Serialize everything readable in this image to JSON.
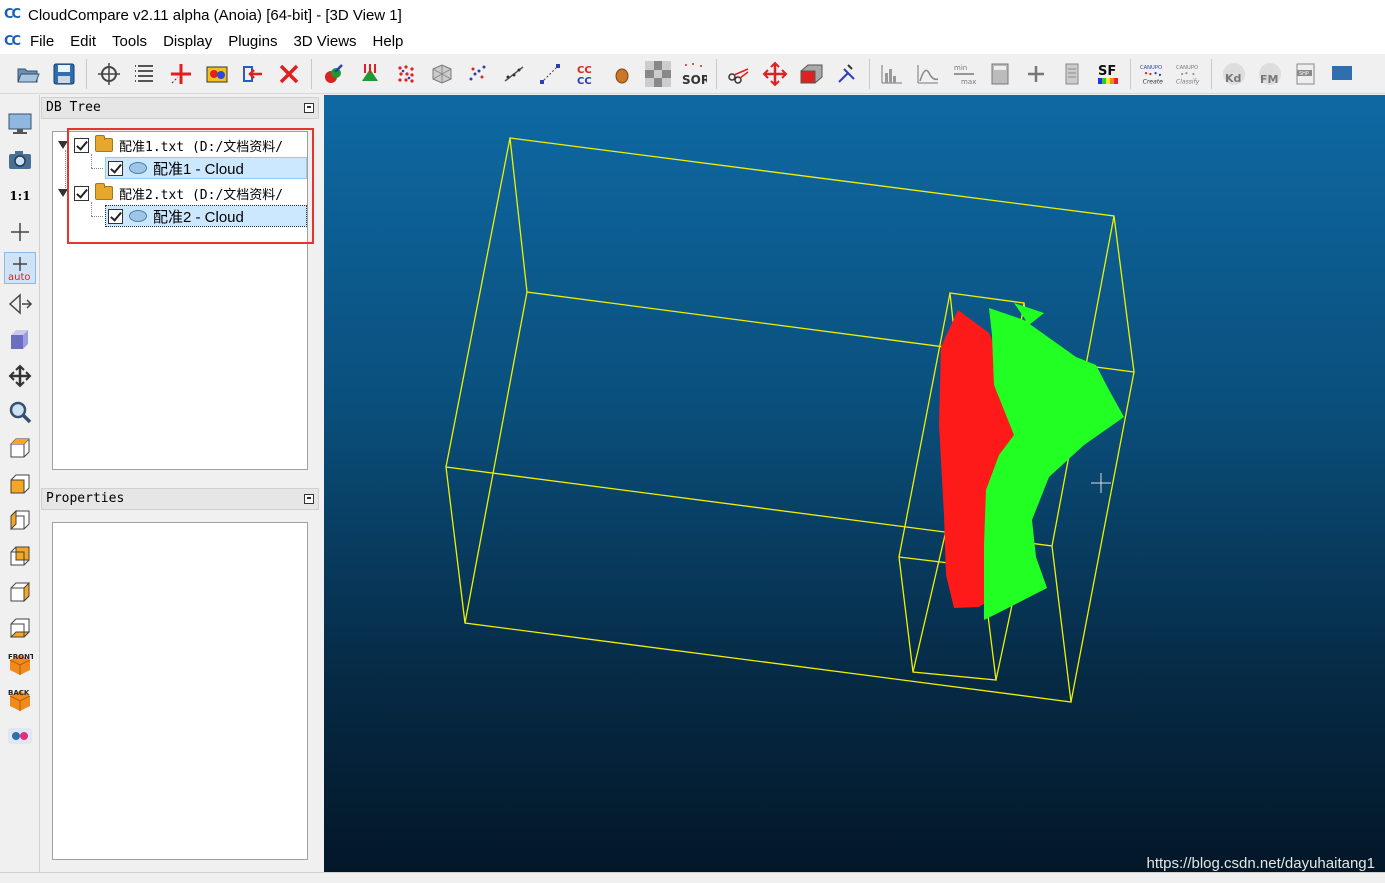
{
  "window": {
    "logo": "CC",
    "title": "CloudCompare v2.11 alpha (Anoia) [64-bit] - [3D View 1]"
  },
  "menubar": {
    "logo": "CC",
    "items": [
      "File",
      "Edit",
      "Tools",
      "Display",
      "Plugins",
      "3D Views",
      "Help"
    ]
  },
  "toolbar": {
    "sor_label": "SOR",
    "sf_label": "SF",
    "cc_label": "CC",
    "minmax_top": "min",
    "minmax_bottom": "max",
    "canupo_create_top": "CANUPO",
    "canupo_create": "Create",
    "canupo_classify_top": "CANUPO",
    "canupo_classify": "Classify",
    "kd_label": "Kd",
    "fm_label": "FM",
    "shp_label": "SHP"
  },
  "left_toolbar": {
    "scale_label": "1:1",
    "auto_label": "auto",
    "front_label": "FRONT",
    "back_label": "BACK"
  },
  "db_tree": {
    "title": "DB Tree",
    "items": [
      {
        "label": "配准1.txt (D:/文档资料/",
        "type": "folder",
        "checked": true
      },
      {
        "label": "配准1 - Cloud",
        "type": "cloud",
        "checked": true
      },
      {
        "label": "配准2.txt (D:/文档资料/",
        "type": "folder",
        "checked": true
      },
      {
        "label": "配准2 - Cloud",
        "type": "cloud",
        "checked": true
      }
    ]
  },
  "properties": {
    "title": "Properties"
  },
  "view3d": {
    "watermark": "https://blog.csdn.net/dayuhaitang1",
    "bbox_color": "#f0f000",
    "cloud1_color": "#ff1a1a",
    "cloud2_color": "#22ff22"
  },
  "colors": {
    "highlight_box": "#e8342f",
    "selection": "#cce8ff"
  }
}
